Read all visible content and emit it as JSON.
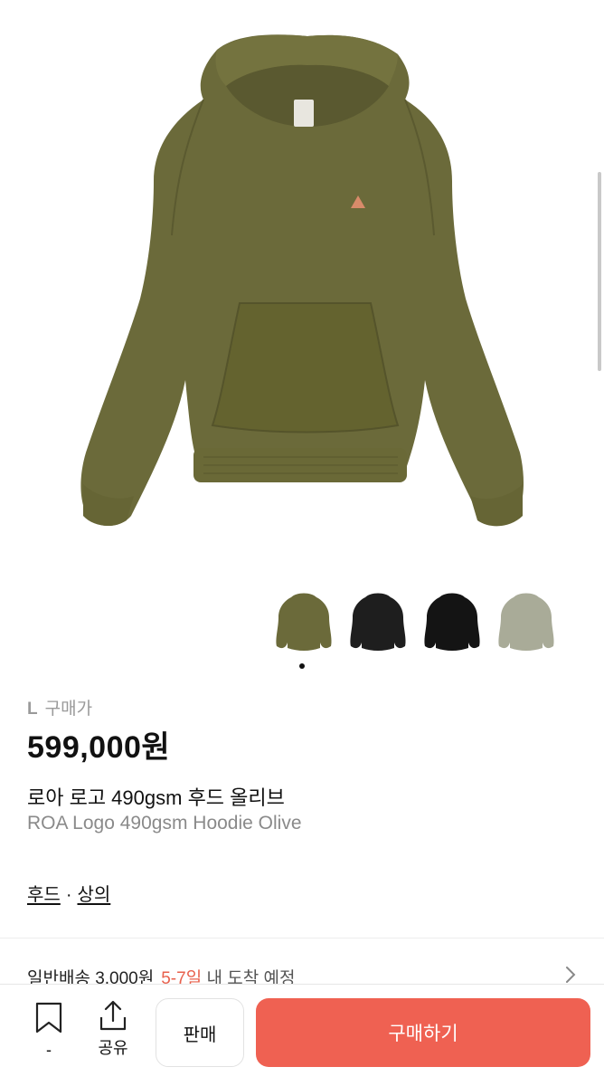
{
  "product": {
    "size": "L",
    "price_label": "구매가",
    "price": "599,000원",
    "name_ko": "로아 로고 490gsm 후드 올리브",
    "name_en": "ROA Logo 490gsm Hoodie Olive"
  },
  "category": {
    "primary": "후드",
    "separator": "·",
    "secondary": "상의"
  },
  "shipping": {
    "type": "일반배송 3,000원",
    "eta": "5-7일",
    "eta_rest": "내 도착 예정"
  },
  "gallery": {
    "thumbnails": [
      {
        "color_name": "olive",
        "color": "#6b6a3a"
      },
      {
        "color_name": "black",
        "color": "#1e1e1e"
      },
      {
        "color_name": "black",
        "color": "#141414"
      },
      {
        "color_name": "sage",
        "color": "#a9ab98"
      }
    ],
    "active_index": 0
  },
  "bottom_bar": {
    "bookmark_count": "-",
    "share_label": "공유",
    "sell_label": "판매",
    "buy_label": "구매하기"
  },
  "colors": {
    "accent": "#ef6152",
    "hoodie": "#6b6a3a"
  }
}
